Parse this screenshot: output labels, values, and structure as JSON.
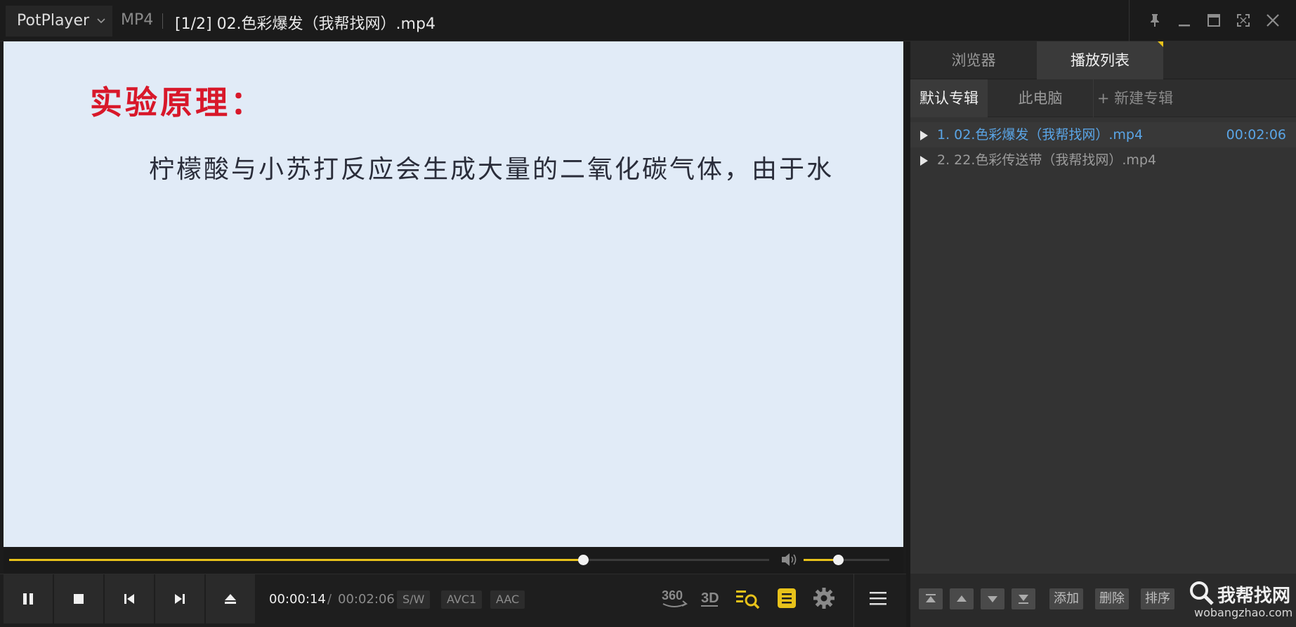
{
  "app": {
    "name": "PotPlayer",
    "format": "MP4",
    "window_title": "[1/2] 02.色彩爆发（我帮找网）.mp4"
  },
  "video": {
    "heading": "实验原理：",
    "body": "柠檬酸与小苏打反应会生成大量的二氧化碳气体，由于水"
  },
  "playback": {
    "current_time": "00:00:14",
    "separator": "/",
    "total_time": "00:02:06",
    "seek_fraction": 0.755,
    "volume_fraction": 0.4,
    "tags": [
      "S/W",
      "AVC1",
      "AAC"
    ]
  },
  "panel": {
    "tabs": [
      "浏览器",
      "播放列表"
    ],
    "albums": [
      "默认专辑",
      "此电脑",
      "+ 新建专辑"
    ],
    "items": [
      {
        "name": "1. 02.色彩爆发（我帮找网）.mp4",
        "duration": "00:02:06"
      },
      {
        "name": "2. 22.色彩传送带（我帮找网）.mp4",
        "duration": ""
      }
    ],
    "buttons": [
      "添加",
      "删除",
      "排序"
    ]
  },
  "watermark": {
    "text": "我帮找网",
    "url": "wobangzhao.com"
  },
  "colors": {
    "accent": "#e8c21a",
    "active_item": "#5aa5e6",
    "heading": "#d8182a",
    "video_bg": "#e1ebf7"
  },
  "icons": [
    "pause-icon",
    "stop-icon",
    "previous-icon",
    "next-icon",
    "eject-icon",
    "vr360-icon",
    "3d-icon",
    "playlist-search-icon",
    "subtitle-icon",
    "settings-icon",
    "menu-icon",
    "volume-icon",
    "pin-icon",
    "minimize-icon",
    "maximize-icon",
    "fullscreen-icon",
    "close-icon"
  ]
}
